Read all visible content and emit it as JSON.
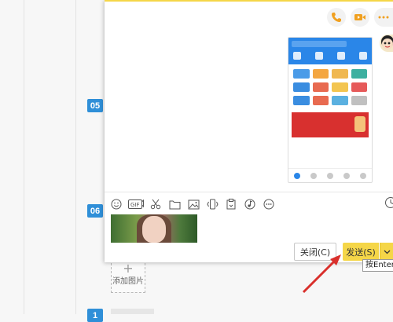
{
  "steps": [
    "05",
    "06",
    "1"
  ],
  "add_image": {
    "plus": "+",
    "label": "添加图片"
  },
  "chat": {
    "top_icons": [
      "phone-icon",
      "video-icon",
      "more-icon"
    ],
    "toolbar_icons": [
      "emoji-icon",
      "gif-icon",
      "scissors-icon",
      "folder-icon",
      "image-icon",
      "shake-icon",
      "clipboard-icon",
      "music-icon",
      "more-icon"
    ],
    "buttons": {
      "close": "关闭(C)",
      "send": "发送(S)"
    },
    "tooltip": "按Enter键"
  },
  "colors": {
    "accent": "#f5d648",
    "step_blue": "#2f8fd8",
    "arrow_red": "#d9302c"
  }
}
